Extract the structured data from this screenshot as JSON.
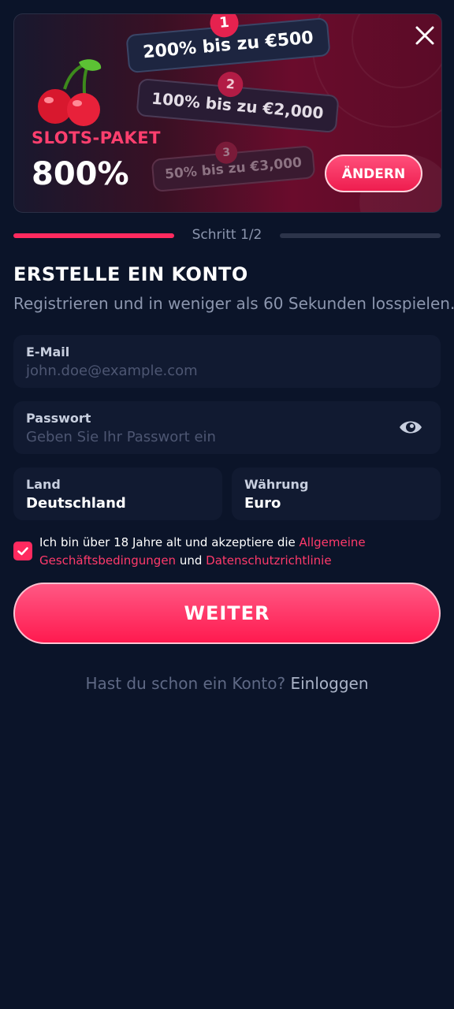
{
  "banner": {
    "package_label": "SLOTS-PAKET",
    "package_percent": "800%",
    "tiers": [
      {
        "number": "1",
        "text": "200% bis zu €500"
      },
      {
        "number": "2",
        "text": "100% bis zu €2,000"
      },
      {
        "number": "3",
        "text": "50% bis zu €3,000"
      }
    ],
    "change_label": "ÄNDERN"
  },
  "progress": {
    "step_label": "Schritt 1/2",
    "current_step": 1,
    "total_steps": 2
  },
  "form": {
    "title": "ERSTELLE EIN KONTO",
    "subtitle": "Registrieren und in weniger als 60 Sekunden losspielen.",
    "email": {
      "label": "E-Mail",
      "placeholder": "john.doe@example.com"
    },
    "password": {
      "label": "Passwort",
      "placeholder": "Geben Sie Ihr Passwort ein"
    },
    "country": {
      "label": "Land",
      "value": "Deutschland"
    },
    "currency": {
      "label": "Währung",
      "value": "Euro"
    },
    "terms": {
      "checked": true,
      "prefix": "Ich bin über 18 Jahre alt und akzeptiere die ",
      "link1": "Allgemeine Geschäftsbedingungen",
      "middle": " und ",
      "link2": "Datenschutzrichtlinie"
    },
    "continue_label": "WEITER",
    "login_prompt": "Hast du schon ein Konto?",
    "login_link": "Einloggen"
  },
  "colors": {
    "background": "#0b1429",
    "accent": "#ff2a5f",
    "field_bg": "#111a31",
    "muted_text": "#8c96ae"
  },
  "icons": {
    "close": "close-icon",
    "eye": "eye-icon",
    "check": "checkmark-icon",
    "cherry": "cherry-icon"
  }
}
